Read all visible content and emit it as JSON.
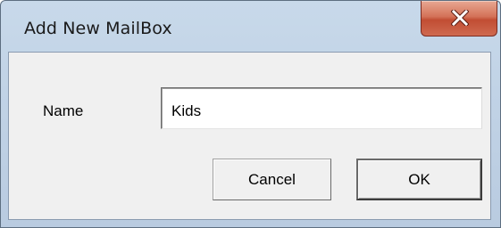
{
  "window": {
    "title": "Add New MailBox",
    "close_icon": "close-x-icon"
  },
  "form": {
    "name_label": "Name",
    "name_value": "Kids"
  },
  "buttons": {
    "cancel_label": "Cancel",
    "ok_label": "OK"
  },
  "colors": {
    "titlebar": "#c1d3e6",
    "close_button": "#c14d33",
    "client_background": "#f0f0f0"
  }
}
